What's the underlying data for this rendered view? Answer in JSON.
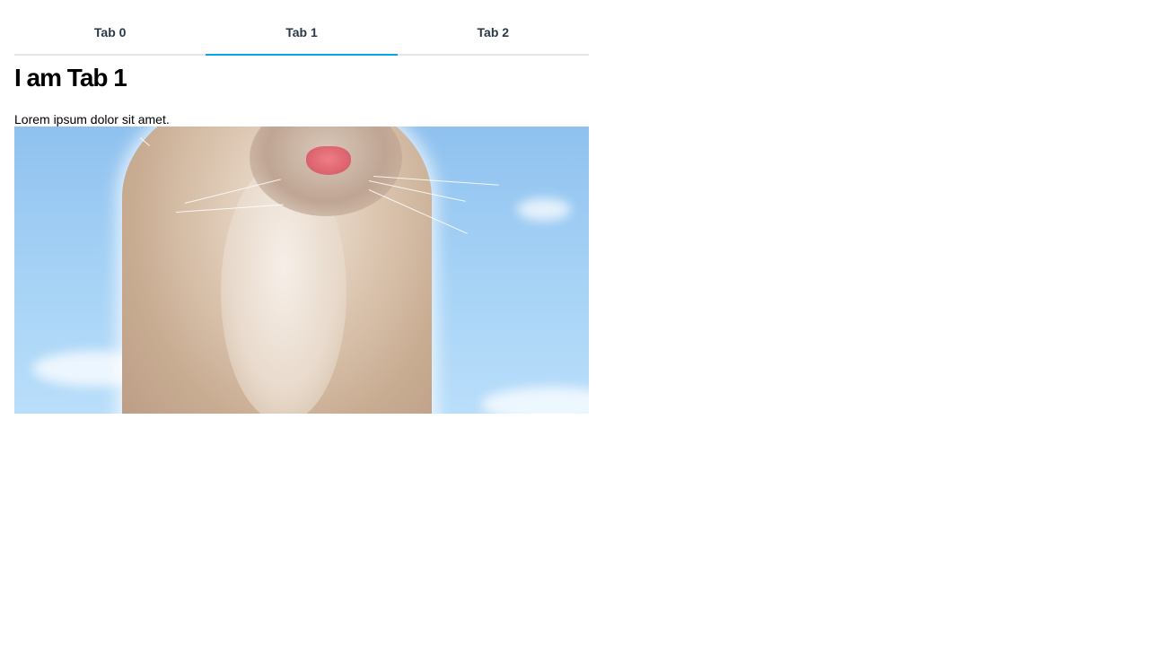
{
  "tabs": [
    {
      "label": "Tab 0",
      "active": false
    },
    {
      "label": "Tab 1",
      "active": true
    },
    {
      "label": "Tab 2",
      "active": false
    }
  ],
  "content": {
    "heading": "I am Tab 1",
    "paragraph": "Lorem ipsum dolor sit amet."
  },
  "colors": {
    "active_tab_indicator": "#0aa6e0",
    "tab_text": "#2a3747",
    "tab_border": "#e5e5e5"
  }
}
